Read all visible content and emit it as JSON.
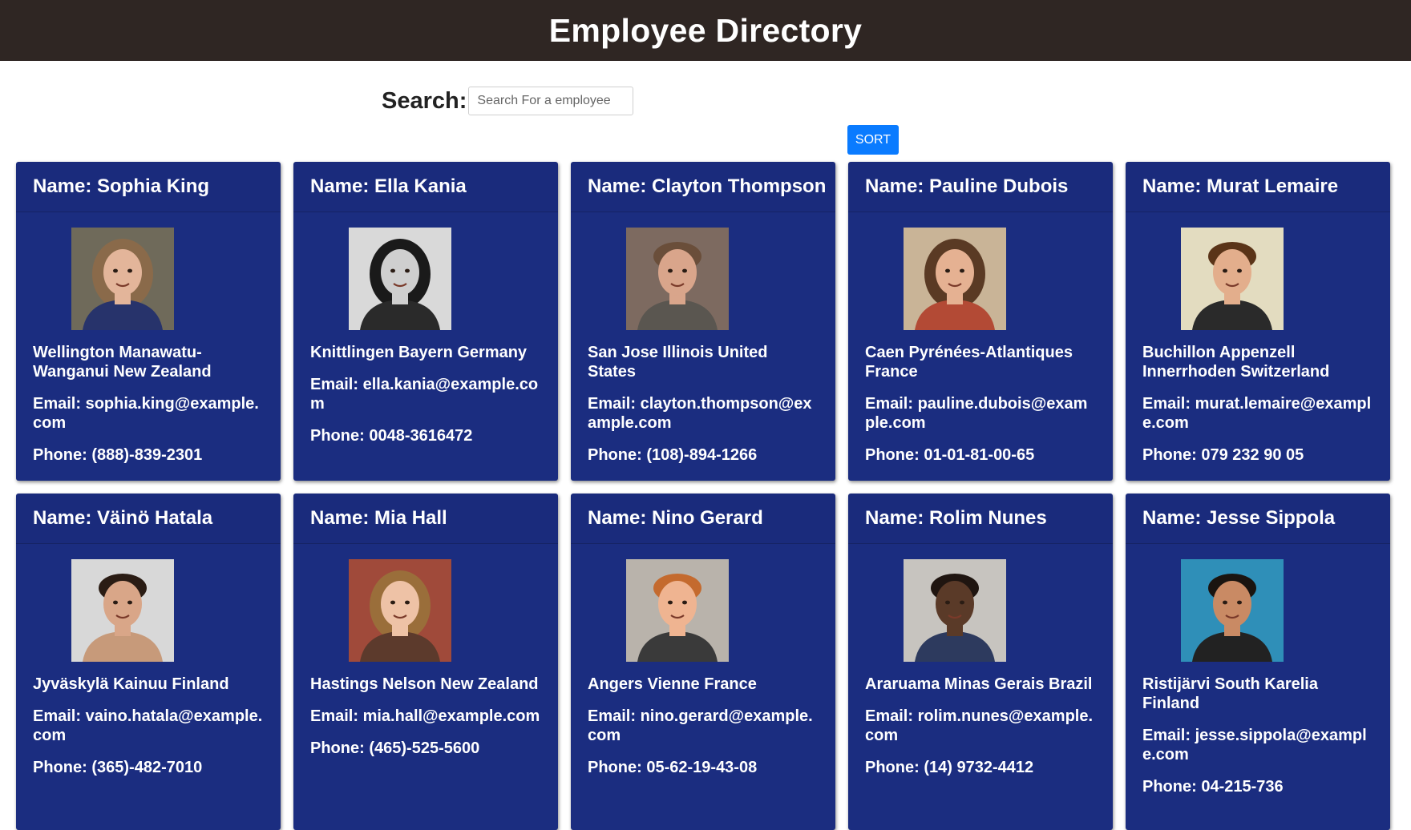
{
  "header": {
    "title": "Employee Directory"
  },
  "search": {
    "label": "Search:",
    "placeholder": "Search For a employee",
    "value": ""
  },
  "sort": {
    "label": "SORT"
  },
  "labels": {
    "name_prefix": "Name: ",
    "email_prefix": "Email: ",
    "phone_prefix": "Phone: "
  },
  "employees": [
    {
      "name": "Sophia King",
      "location": "Wellington Manawatu-Wanganui New Zealand",
      "email": "sophia.king@example.com",
      "phone": "(888)-839-2301",
      "photo": "woman-portrait-icon",
      "bg": "#6f6a5a",
      "skin": "#e3b59a",
      "hair": "#8a6a4a",
      "shirt": "#27336b"
    },
    {
      "name": "Ella Kania",
      "location": "Knittlingen Bayern Germany",
      "email": "ella.kania@example.com",
      "phone": "0048-3616472",
      "photo": "woman-portrait-icon",
      "bg": "#d9d9d9",
      "skin": "#cfcfcf",
      "hair": "#1a1a1a",
      "shirt": "#2a2a2a"
    },
    {
      "name": "Clayton Thompson",
      "location": "San Jose Illinois United States",
      "email": "clayton.thompson@example.com",
      "phone": "(108)-894-1266",
      "photo": "man-portrait-icon",
      "bg": "#7d6a60",
      "skin": "#d9a58b",
      "hair": "#6a4e3a",
      "shirt": "#5a5650"
    },
    {
      "name": "Pauline Dubois",
      "location": "Caen Pyrénées-Atlantiques France",
      "email": "pauline.dubois@example.com",
      "phone": "01-01-81-00-65",
      "photo": "woman-portrait-icon",
      "bg": "#c9b497",
      "skin": "#e5b192",
      "hair": "#5a3a24",
      "shirt": "#b34a35"
    },
    {
      "name": "Murat Lemaire",
      "location": "Buchillon Appenzell Innerrhoden Switzerland",
      "email": "murat.lemaire@example.com",
      "phone": "079 232 90 05",
      "photo": "man-portrait-icon",
      "bg": "#e3dcc0",
      "skin": "#e3ae8c",
      "hair": "#5a3418",
      "shirt": "#2a2a2a"
    },
    {
      "name": "Väinö Hatala",
      "location": "Jyväskylä Kainuu Finland",
      "email": "vaino.hatala@example.com",
      "phone": "(365)-482-7010",
      "photo": "man-portrait-icon",
      "bg": "#d8d8d8",
      "skin": "#d9a688",
      "hair": "#2a1c14",
      "shirt": "#c79a7a"
    },
    {
      "name": "Mia Hall",
      "location": "Hastings Nelson New Zealand",
      "email": "mia.hall@example.com",
      "phone": "(465)-525-5600",
      "photo": "woman-portrait-icon",
      "bg": "#a04a3a",
      "skin": "#eec2a6",
      "hair": "#9a6e3a",
      "shirt": "#5c3a2c"
    },
    {
      "name": "Nino Gerard",
      "location": "Angers Vienne France",
      "email": "nino.gerard@example.com",
      "phone": "05-62-19-43-08",
      "photo": "man-portrait-icon",
      "bg": "#b9b3ab",
      "skin": "#efb491",
      "hair": "#c46a2e",
      "shirt": "#3a3a3a"
    },
    {
      "name": "Rolim Nunes",
      "location": "Araruama Minas Gerais Brazil",
      "email": "rolim.nunes@example.com",
      "phone": "(14) 9732-4412",
      "photo": "man-portrait-icon",
      "bg": "#c7c4bf",
      "skin": "#5a3a28",
      "hair": "#1f1510",
      "shirt": "#2d3a5e"
    },
    {
      "name": "Jesse Sippola",
      "location": "Ristijärvi South Karelia Finland",
      "email": "jesse.sippola@example.com",
      "phone": "04-215-736",
      "photo": "man-portrait-icon",
      "bg": "#2f8fb8",
      "skin": "#c98a64",
      "hair": "#1a1410",
      "shirt": "#222222"
    }
  ]
}
